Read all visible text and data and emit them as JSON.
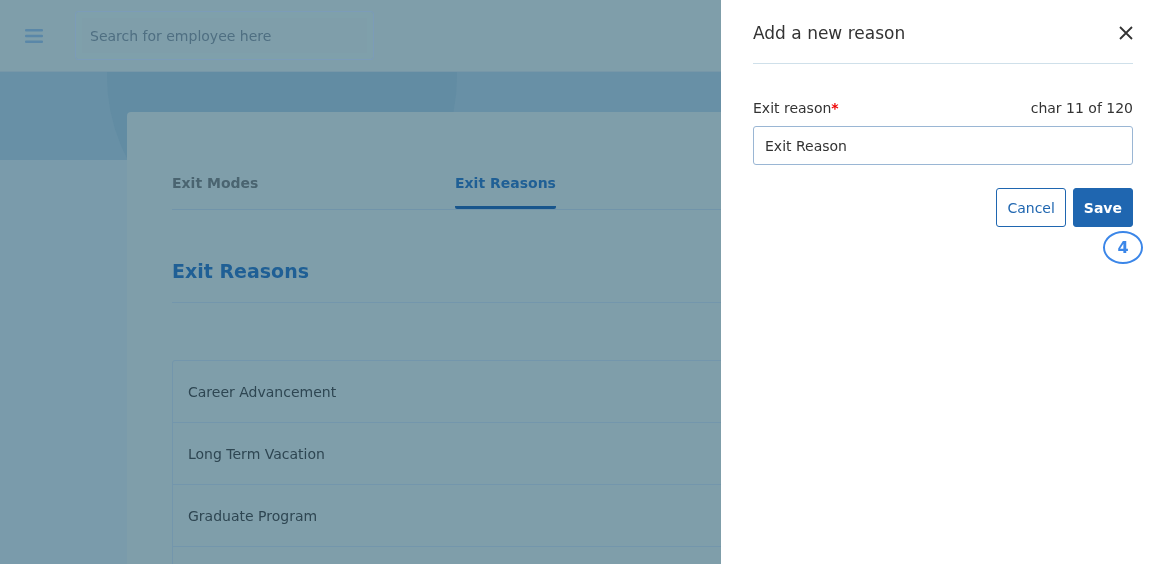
{
  "topbar": {
    "search": {
      "placeholder": "Search for employee here"
    }
  },
  "tabs": [
    {
      "label": "Exit Modes",
      "selected": false
    },
    {
      "label": "Exit Reasons",
      "selected": true
    }
  ],
  "section_title": "Exit Reasons",
  "reasons": [
    "Career Advancement",
    "Long Term Vacation",
    "Graduate Program"
  ],
  "drawer": {
    "title": "Add a new reason",
    "field": {
      "label": "Exit reason",
      "required_mark": "*",
      "counter": "char 11 of 120",
      "value": "Exit Reason"
    },
    "buttons": [
      {
        "label": "Cancel",
        "kind": "secondary"
      },
      {
        "label": "Save",
        "kind": "primary"
      }
    ],
    "step_badge": "4"
  }
}
